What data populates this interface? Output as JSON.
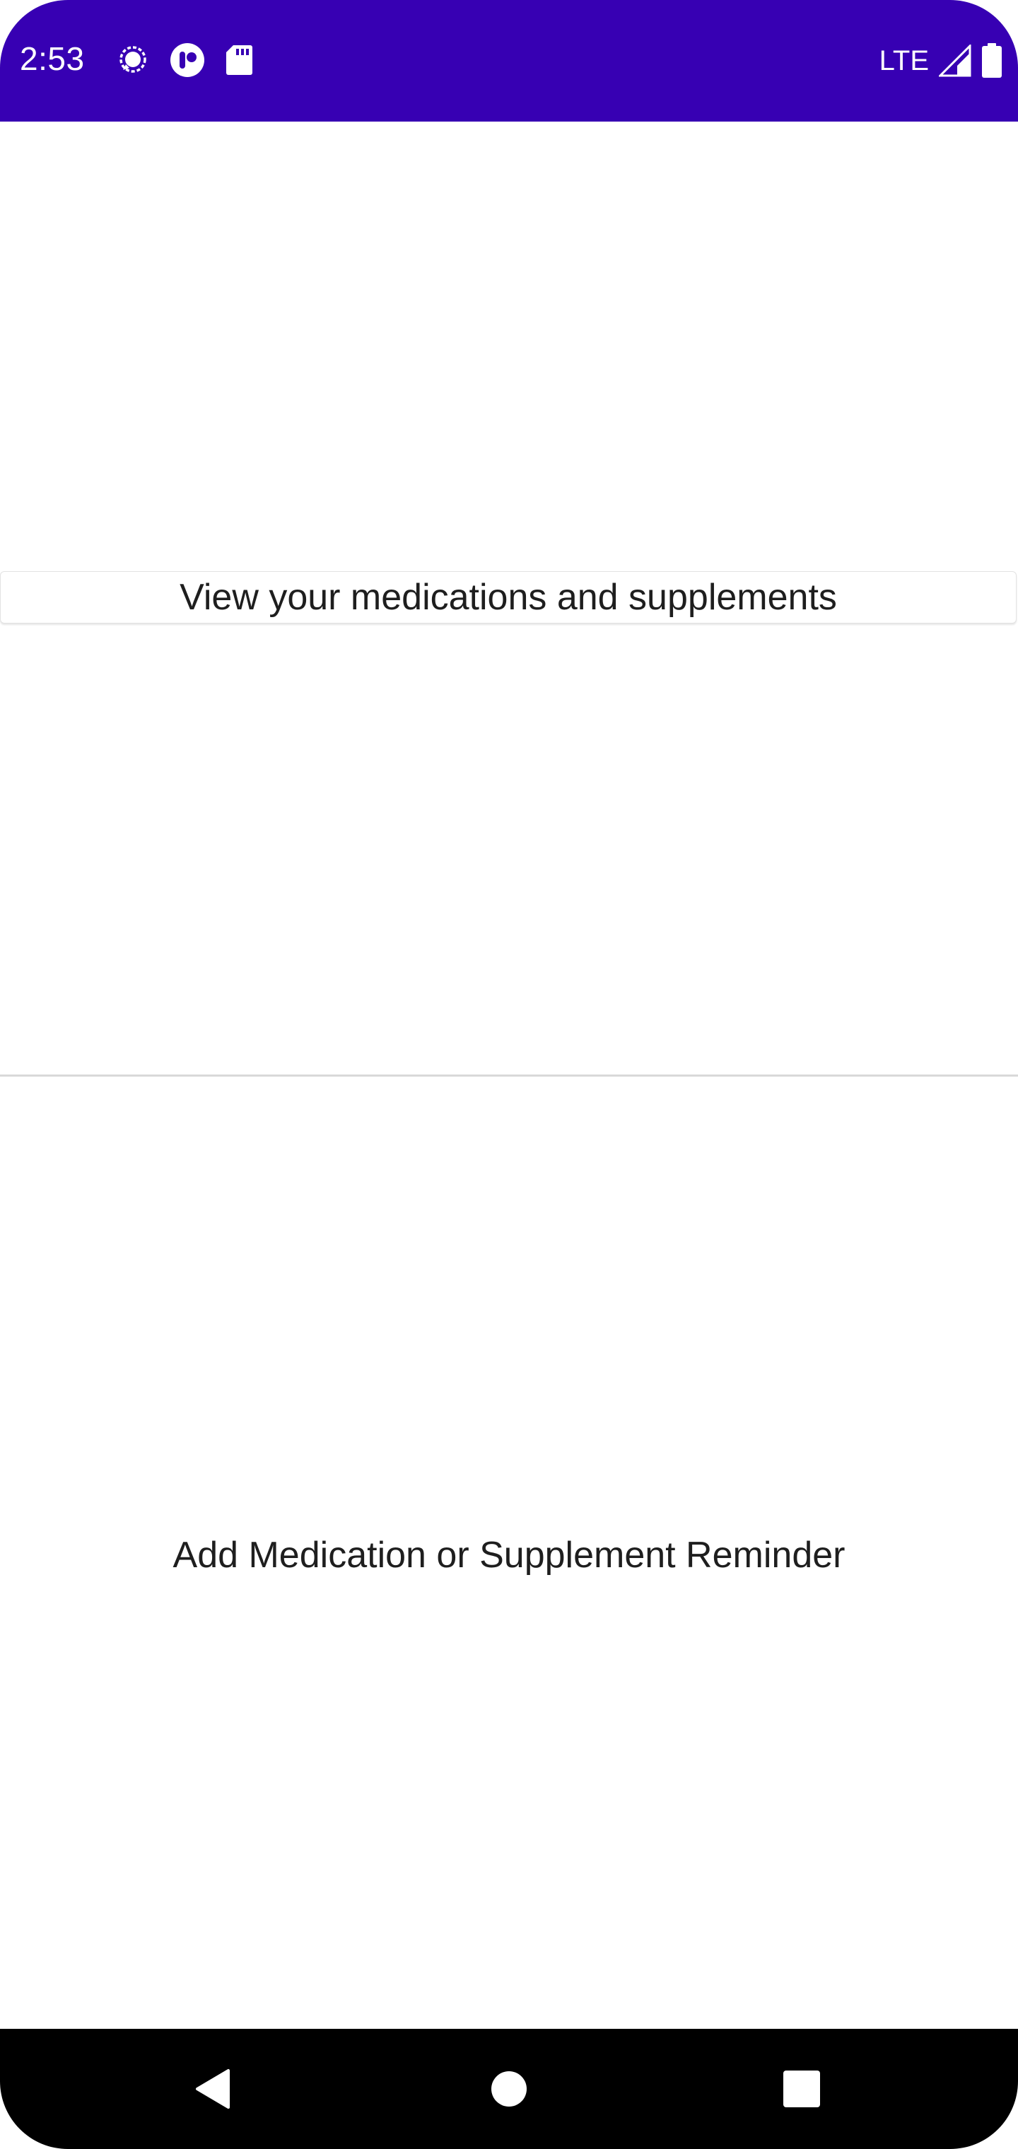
{
  "status_bar": {
    "time": "2:53",
    "network": "LTE",
    "background_color": "#3700b3",
    "left_icons": [
      "signal-messenger-icon",
      "podcast-app-icon",
      "sd-card-icon"
    ],
    "right_icons": [
      "cell-signal-icon",
      "battery-icon"
    ]
  },
  "main": {
    "view_button_label": "View your medications and supplements",
    "add_reminder_label": "Add Medication or Supplement Reminder"
  },
  "nav_bar": {
    "icons": [
      "back-icon",
      "home-icon",
      "recents-icon"
    ]
  }
}
